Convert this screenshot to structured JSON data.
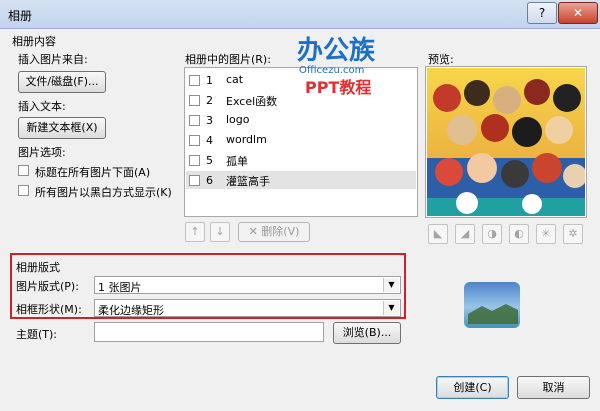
{
  "window": {
    "title": "相册",
    "help_btn": "?",
    "close_btn": "✕"
  },
  "content_section": {
    "heading": "相册内容",
    "insert_from_label": "插入图片来自:",
    "file_disk_button": "文件/磁盘(F)...",
    "insert_text_label": "插入文本:",
    "new_textbox_button": "新建文本框(X)",
    "picture_options_label": "图片选项:",
    "options": [
      {
        "label": "标题在所有图片下面(A)",
        "checked": false
      },
      {
        "label": "所有图片以黑白方式显示(K)",
        "checked": false
      }
    ]
  },
  "pictures_list": {
    "label": "相册中的图片(R):",
    "items": [
      {
        "num": "1",
        "name": "cat"
      },
      {
        "num": "2",
        "name": "Excel函数"
      },
      {
        "num": "3",
        "name": "logo"
      },
      {
        "num": "4",
        "name": "wordlm"
      },
      {
        "num": "5",
        "name": "孤单"
      },
      {
        "num": "6",
        "name": "灌篮高手"
      }
    ],
    "selected_index": 5,
    "remove_button": "删除(V)"
  },
  "preview": {
    "label": "预览:"
  },
  "watermark": {
    "logo_text": "办公族",
    "site": "Officezu.com",
    "tag": "PPT教程"
  },
  "layout_section": {
    "heading": "相册版式",
    "picture_layout_label": "图片版式(P):",
    "picture_layout_value": "1 张图片",
    "frame_shape_label": "相框形状(M):",
    "frame_shape_value": "柔化边缘矩形",
    "highlight_color": "#d0202a"
  },
  "theme": {
    "label": "主题(T):",
    "value": "",
    "browse_button": "浏览(B)..."
  },
  "footer": {
    "create_button": "创建(C)",
    "cancel_button": "取消"
  }
}
